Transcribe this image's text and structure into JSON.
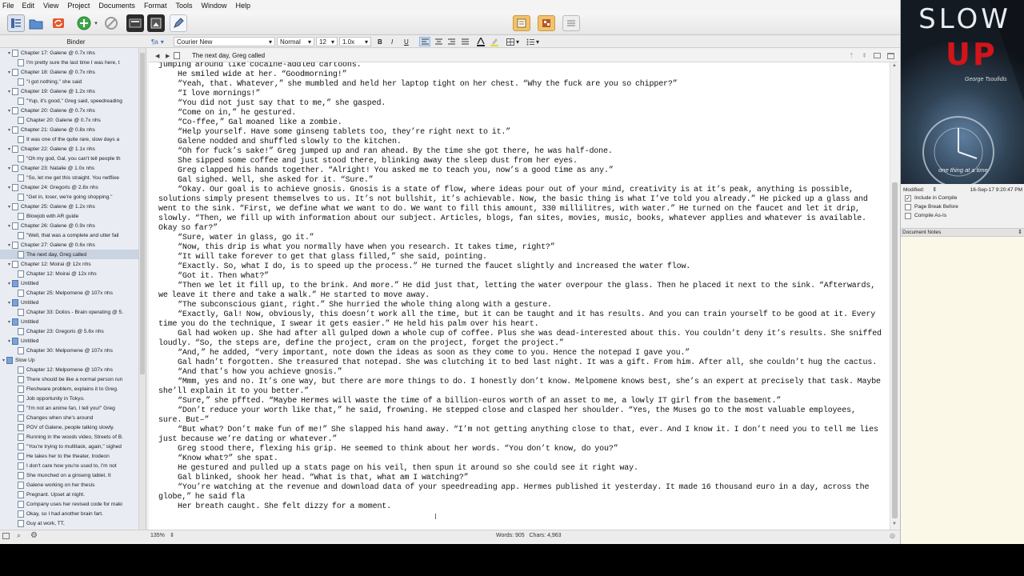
{
  "menubar": [
    "File",
    "Edit",
    "View",
    "Project",
    "Documents",
    "Format",
    "Tools",
    "Window",
    "Help"
  ],
  "formatbar": {
    "style_placeholder": "¶a",
    "font": "Courier New",
    "style": "Normal",
    "size": "12",
    "spacing": "1.0x",
    "bold": "B",
    "italic": "I",
    "underline": "U"
  },
  "binder": {
    "title": "Binder",
    "items": [
      {
        "label": "Chapter 17: Galene @ 0.7x nhs",
        "type": "doc",
        "indent": 1,
        "twist": "▾"
      },
      {
        "label": "I'm pretty sure the last time I was here, t",
        "type": "doc",
        "indent": 2,
        "twist": ""
      },
      {
        "label": "Chapter 18: Galene @ 0.7x nhs",
        "type": "doc",
        "indent": 1,
        "twist": "▾"
      },
      {
        "label": "\"I got nothing,\" she said",
        "type": "doc",
        "indent": 2,
        "twist": ""
      },
      {
        "label": "Chapter 19: Galene @ 1.2x nhs",
        "type": "doc",
        "indent": 1,
        "twist": "▾"
      },
      {
        "label": "\"Yup, it's good,\" Greg said, speedreading",
        "type": "doc",
        "indent": 2,
        "twist": ""
      },
      {
        "label": "Chapter 20: Galene @ 0.7x nhs",
        "type": "doc",
        "indent": 1,
        "twist": "▾"
      },
      {
        "label": "Chapter 20: Galene @ 0.7x nhs",
        "type": "doc",
        "indent": 2,
        "twist": ""
      },
      {
        "label": "Chapter 21: Galene @ 0.8x nhs",
        "type": "doc",
        "indent": 1,
        "twist": "▾"
      },
      {
        "label": "It was one of the quite rare, slow days a",
        "type": "doc",
        "indent": 2,
        "twist": ""
      },
      {
        "label": "Chapter 22: Galene @ 1.1x nhs",
        "type": "doc",
        "indent": 1,
        "twist": "▾"
      },
      {
        "label": "\"Oh my god, Gal, you can't tell people th",
        "type": "doc",
        "indent": 2,
        "twist": ""
      },
      {
        "label": "Chapter 23: Natalie @ 1.0x nhs",
        "type": "doc",
        "indent": 1,
        "twist": "▾"
      },
      {
        "label": "\"So, let me get this straight. You netflixe",
        "type": "doc",
        "indent": 2,
        "twist": ""
      },
      {
        "label": "Chapter 24: Gregoris @ 2.8x nhs",
        "type": "doc",
        "indent": 1,
        "twist": "▾"
      },
      {
        "label": "\"Get in, loser, we're going shopping.\"",
        "type": "doc",
        "indent": 2,
        "twist": ""
      },
      {
        "label": "Chapter 25: Galene @ 1.2x nhs",
        "type": "doc",
        "indent": 1,
        "twist": "▾"
      },
      {
        "label": "Blowjob with AR guide",
        "type": "doc",
        "indent": 2,
        "twist": ""
      },
      {
        "label": "Chapter 26: Galene @ 0.9x nhs",
        "type": "doc",
        "indent": 1,
        "twist": "▾"
      },
      {
        "label": "\"Well, that was a complete and utter fail",
        "type": "doc",
        "indent": 2,
        "twist": ""
      },
      {
        "label": "Chapter 27: Galene @ 0.6x nhs",
        "type": "doc",
        "indent": 1,
        "twist": "▾"
      },
      {
        "label": "The next day, Greg called",
        "type": "doc",
        "indent": 2,
        "twist": "",
        "selected": true
      },
      {
        "label": "Chapter 12: Moirai @ 12x nhs",
        "type": "doc",
        "indent": 1,
        "twist": "▾"
      },
      {
        "label": "Chapter 12: Moirai @ 12x nhs",
        "type": "doc",
        "indent": 2,
        "twist": ""
      },
      {
        "label": "Untitled",
        "type": "folder",
        "indent": 1,
        "twist": "▾"
      },
      {
        "label": "Chapter 25: Melpomene @ 107x nhs",
        "type": "doc",
        "indent": 2,
        "twist": ""
      },
      {
        "label": "Untitled",
        "type": "folder",
        "indent": 1,
        "twist": "▾"
      },
      {
        "label": "Chapter 33: Dolios - Brain operating @ 5.",
        "type": "doc",
        "indent": 2,
        "twist": ""
      },
      {
        "label": "Untitled",
        "type": "folder",
        "indent": 1,
        "twist": "▾"
      },
      {
        "label": "Chapter 23: Gregoris @ 5.6x nhs",
        "type": "doc",
        "indent": 2,
        "twist": ""
      },
      {
        "label": "Untitled",
        "type": "folder",
        "indent": 1,
        "twist": "▾"
      },
      {
        "label": "Chapter 30: Melpomene @ 107x nhs",
        "type": "doc",
        "indent": 2,
        "twist": ""
      },
      {
        "label": "Slow Up",
        "type": "folder",
        "indent": 0,
        "twist": "▾"
      },
      {
        "label": "Chapter 12: Melpomene @ 107x nhs",
        "type": "doc",
        "indent": 2,
        "twist": ""
      },
      {
        "label": "There should be like a normal person run",
        "type": "doc",
        "indent": 2,
        "twist": ""
      },
      {
        "label": "Fleshware problem, explains it to Greg.",
        "type": "doc",
        "indent": 2,
        "twist": ""
      },
      {
        "label": "Job opportunity in Tokyo.",
        "type": "doc",
        "indent": 2,
        "twist": ""
      },
      {
        "label": "\"I'm not an anime fan, I tell you!\" Greg",
        "type": "doc",
        "indent": 2,
        "twist": ""
      },
      {
        "label": "Changes when she's around",
        "type": "doc",
        "indent": 2,
        "twist": ""
      },
      {
        "label": "POV of Galene, people talking slowly.",
        "type": "doc",
        "indent": 2,
        "twist": ""
      },
      {
        "label": "Running in the woods video, Streets of B.",
        "type": "doc",
        "indent": 2,
        "twist": ""
      },
      {
        "label": "\"You're trying to multitask, again,\" sighed",
        "type": "doc",
        "indent": 2,
        "twist": ""
      },
      {
        "label": "He takes her to the theater, Irodeon",
        "type": "doc",
        "indent": 2,
        "twist": ""
      },
      {
        "label": "I don't care how you're used to, I'm not",
        "type": "doc",
        "indent": 2,
        "twist": ""
      },
      {
        "label": "She munched on a ginseng tablet. It",
        "type": "doc",
        "indent": 2,
        "twist": ""
      },
      {
        "label": "Galene working on her thesis",
        "type": "doc",
        "indent": 2,
        "twist": ""
      },
      {
        "label": "Pregnant. Upset at night.",
        "type": "doc",
        "indent": 2,
        "twist": ""
      },
      {
        "label": "Company uses her revised code for maki",
        "type": "doc",
        "indent": 2,
        "twist": ""
      },
      {
        "label": "Okay, so I had another brain fart.",
        "type": "doc",
        "indent": 2,
        "twist": ""
      },
      {
        "label": "Guy at work, TT,",
        "type": "doc",
        "indent": 2,
        "twist": ""
      }
    ]
  },
  "editor": {
    "doc_title": "The next day, Greg called",
    "paragraphs": [
      {
        "indent": false,
        "text": "jumping around like cocaine-addled cartoons."
      },
      {
        "indent": true,
        "text": "He smiled wide at her. “Goodmorning!”"
      },
      {
        "indent": true,
        "text": "“Yeah, that. Whatever,” she mumbled and held her laptop tight on her chest. “Why the fuck are you so chipper?”"
      },
      {
        "indent": true,
        "text": "“I love mornings!”"
      },
      {
        "indent": true,
        "text": "“You did not just say that to me,” she gasped."
      },
      {
        "indent": true,
        "text": "“Come on in,” he gestured."
      },
      {
        "indent": true,
        "text": "“Co-ffee,” Gal moaned like a zombie."
      },
      {
        "indent": true,
        "text": "“Help yourself. Have some ginseng tablets too, they’re right next to it.”"
      },
      {
        "indent": true,
        "text": "Galene nodded and shuffled slowly to the kitchen."
      },
      {
        "indent": true,
        "text": "“Oh for fuck’s sake!” Greg jumped up and ran ahead. By the time she got there, he was half-done."
      },
      {
        "indent": true,
        "text": "She sipped some coffee and just stood there, blinking away the sleep dust from her eyes."
      },
      {
        "indent": true,
        "text": "Greg clapped his hands together. “Alright! You asked me to teach you, now’s a good time as any.”"
      },
      {
        "indent": true,
        "text": "Gal sighed. Well, she asked for it. “Sure.”"
      },
      {
        "indent": true,
        "text": "“Okay. Our goal is to achieve gnosis. Gnosis is a state of flow, where ideas pour out of your mind, creativity is at it’s peak, anything is possible, solutions simply present themselves to us. It’s not bullshit, it’s achievable. Now, the basic thing is what I’ve told you already.” He picked up a glass and went to the sink. “First, we define what we want to do. We want to fill this amount, 330 millilitres, with water.” He turned on the faucet and let it drip, slowly. “Then, we fill up with information about our subject. Articles, blogs, fan sites, movies, music, books, whatever applies and whatever is available. Okay so far?”"
      },
      {
        "indent": true,
        "text": "“Sure, water in glass, go it.”"
      },
      {
        "indent": true,
        "text": "“Now, this drip is what you normally have when you research. It takes time, right?”"
      },
      {
        "indent": true,
        "text": "“It will take forever to get that glass filled,” she said, pointing."
      },
      {
        "indent": true,
        "text": "“Exactly. So, what I do, is to speed up the process.” He turned the faucet slightly and increased the water flow."
      },
      {
        "indent": true,
        "text": "“Got it. Then what?”"
      },
      {
        "indent": true,
        "text": "“Then we let it fill up, to the brink. And more.” He did just that, letting the water overpour the glass. Then he placed it next to the sink. “Afterwards, we leave it there and take a walk.” He started to move away."
      },
      {
        "indent": true,
        "text": "“The subconscious giant, right.” She hurried the whole thing along with a gesture."
      },
      {
        "indent": true,
        "text": "“Exactly, Gal! Now, obviously, this doesn’t work all the time, but it can be taught and it has results. And you can train yourself to be good at it. Every time you do the technique, I swear it gets easier.” He held his palm over his heart."
      },
      {
        "indent": true,
        "text": "Gal had woken up. She had after all gulped down a whole cup of coffee. Plus she was dead-interested about this. You couldn’t deny it’s results. She sniffed loudly. “So, the steps are, define the project, cram on the project, forget the project.”"
      },
      {
        "indent": true,
        "text": "“And,” he added, “very important, note down the ideas as soon as they come to you. Hence the notepad I gave you.”"
      },
      {
        "indent": true,
        "text": "Gal hadn’t forgotten. She treasured that notepad. She was clutching it to bed last night. It was a gift. From him. After all, she couldn’t hug the cactus."
      },
      {
        "indent": true,
        "text": "“And that’s how you achieve gnosis.”"
      },
      {
        "indent": true,
        "text": "“Mmm, yes and no. It’s one way, but there are more things to do. I honestly don’t know. Melpomene knows best, she’s an expert at precisely that task. Maybe she’ll explain it to you better.”"
      },
      {
        "indent": true,
        "text": "“Sure,” she pffted. “Maybe Hermes will waste the time of a billion-euros worth of an asset to me, a lowly IT girl from the basement.”"
      },
      {
        "indent": true,
        "text": "“Don’t reduce your worth like that,” he said, frowning. He stepped close and clasped her shoulder. “Yes, the Muses go to the most valuable employees, sure. But–”"
      },
      {
        "indent": true,
        "text": "“But what? Don’t make fun of me!” She slapped his hand away. “I’m not getting anything close to that, ever. And I know it. I don’t need you to tell me lies just because we’re dating or whatever.”"
      },
      {
        "indent": true,
        "text": "Greg stood there, flexing his grip. He seemed to think about her words. “You don’t know, do you?”"
      },
      {
        "indent": true,
        "text": "“Know what?” she spat."
      },
      {
        "indent": true,
        "text": "He gestured and pulled up a stats page on his veil, then spun it around so she could see it right way."
      },
      {
        "indent": true,
        "text": "Gal blinked, shook her head. “What is that, what am I watching?”"
      },
      {
        "indent": true,
        "text": "“You’re watching at the revenue and download data of your speedreading app. Hermes published it yesterday. It made 16 thousand euro in a day, across the globe,” he said fla"
      },
      {
        "indent": true,
        "text": "Her breath caught. She felt dizzy for a moment."
      }
    ]
  },
  "footer": {
    "zoom": "135%",
    "counts": "Words: 905   Chars: 4,963"
  },
  "inspector": {
    "cover_title1": "SLOW",
    "cover_title2": "UP",
    "cover_author": "George Tsoufidis",
    "cover_tagline": "one thing at a time",
    "modified_label": "Modified:",
    "modified_value": "16-Sep-17 9:20:47 PM",
    "checks": [
      {
        "label": "Include in Compile",
        "checked": true
      },
      {
        "label": "Page Break Before",
        "checked": false
      },
      {
        "label": "Compile As-Is",
        "checked": false
      }
    ],
    "notes_label": "Document Notes"
  },
  "colors": {
    "selection": "#c9d3e1",
    "notes_bg": "#fbf8e8",
    "cover_red": "#d3141a"
  }
}
